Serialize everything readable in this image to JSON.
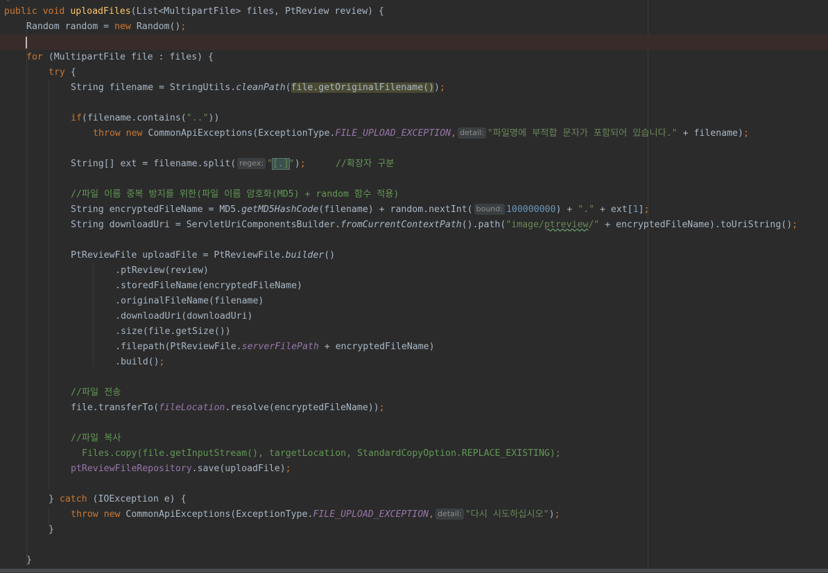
{
  "editor": {
    "top_partial": "{",
    "lines": {
      "l1": {
        "kw_public": "public",
        "kw_void": "void",
        "method": "uploadFiles",
        "params": "(List<MultipartFile> files, PtReview review) {"
      },
      "l2": {
        "a": "Random random = ",
        "kw_new": "new",
        "b": " Random()",
        "semi": ";"
      },
      "l4": {
        "kw_for": "for",
        "rest": " (MultipartFile file : files) {"
      },
      "l5": {
        "kw_try": "try",
        "rest": " {"
      },
      "l6": {
        "a": "String filename = StringUtils.",
        "m": "cleanPath",
        "b": "(",
        "sel": "file.getOriginalFilename()",
        "c": ")",
        "semi": ";"
      },
      "l8": {
        "kw_if": "if",
        "a": "(filename.contains(",
        "s": "\"..\"",
        "b": "))"
      },
      "l9": {
        "kw_throw": "throw",
        "kw_new": "new",
        "a": " CommonApiExceptions(ExceptionType.",
        "c": "FILE_UPLOAD_EXCEPTION",
        "comma": ",",
        "hint": "detail:",
        "s": "\"파일명에 부적합 문자가 포함되어 있습니다.\"",
        "b": " + filename)",
        "semi": ";"
      },
      "l11": {
        "a": "String[] ext = filename.split(",
        "hint": "regex:",
        "q1": "\"",
        "rx": "[.]",
        "q2": "\"",
        "b": ")",
        "semi": ";",
        "cmt": "//확장자 구분"
      },
      "l13": {
        "cmt": "//파일 이름 중복 방지를 위한(파일 이름 암호화(MD5) + random 함수 적용)"
      },
      "l14": {
        "a": "String encryptedFileName = MD5.",
        "m": "getMD5HashCode",
        "b": "(filename) + random.nextInt(",
        "hint": "bound:",
        "n": "100000000",
        "c": ") + ",
        "s": "\".\"",
        "d": " + ext[",
        "n2": "1",
        "e": "]",
        "semi": ";"
      },
      "l15": {
        "a": "String downloadUri = ServletUriComponentsBuilder.",
        "m": "fromCurrentContextPath",
        "b": "().path(",
        "s1": "\"image/",
        "s2": "ptreview",
        "s3": "/\"",
        "c": " + encryptedFileName).toUriString()",
        "semi": ";"
      },
      "l17": {
        "a": "PtReviewFile uploadFile = PtReviewFile.",
        "m": "builder",
        "b": "()"
      },
      "l18": {
        "a": ".ptReview(review)"
      },
      "l19": {
        "a": ".storedFileName(encryptedFileName)"
      },
      "l20": {
        "a": ".originalFileName(filename)"
      },
      "l21": {
        "a": ".downloadUri(downloadUri)"
      },
      "l22": {
        "a": ".size(file.getSize())"
      },
      "l23": {
        "a": ".filepath(PtReviewFile.",
        "f": "serverFilePath",
        "b": " + encryptedFileName)"
      },
      "l24": {
        "a": ".build()",
        "semi": ";"
      },
      "l26": {
        "cmt": "//파일 전송"
      },
      "l27": {
        "a": "file.transferTo(",
        "f": "fileLocation",
        "b": ".resolve(encryptedFileName))",
        "semi": ";"
      },
      "l29": {
        "cmt": "//파일 복사"
      },
      "l30": {
        "cmtcode": "Files.copy(file.getInputStream(), targetLocation, StandardCopyOption.REPLACE_EXISTING);"
      },
      "l31": {
        "f": "ptReviewFileRepository",
        "a": ".save(uploadFile)",
        "semi": ";"
      },
      "l33": {
        "a": "} ",
        "kw_catch": "catch",
        "b": " (IOException e) {"
      },
      "l34": {
        "kw_throw": "throw",
        "kw_new": "new",
        "a": " CommonApiExceptions(ExceptionType.",
        "c": "FILE_UPLOAD_EXCEPTION",
        "comma": ",",
        "hint": "detail:",
        "s": "\"다시 시도하십시오\"",
        "b": ")",
        "semi": ";"
      },
      "l35": {
        "a": "}"
      },
      "l37": {
        "a": "}"
      }
    }
  },
  "colors": {
    "background": "#2b2b2b",
    "keyword": "#cc7832",
    "method_decl": "#ffc66d",
    "string": "#6a8759",
    "number": "#6897bb",
    "constant": "#9876aa",
    "comment": "#629755",
    "default_text": "#a9b7c6"
  }
}
